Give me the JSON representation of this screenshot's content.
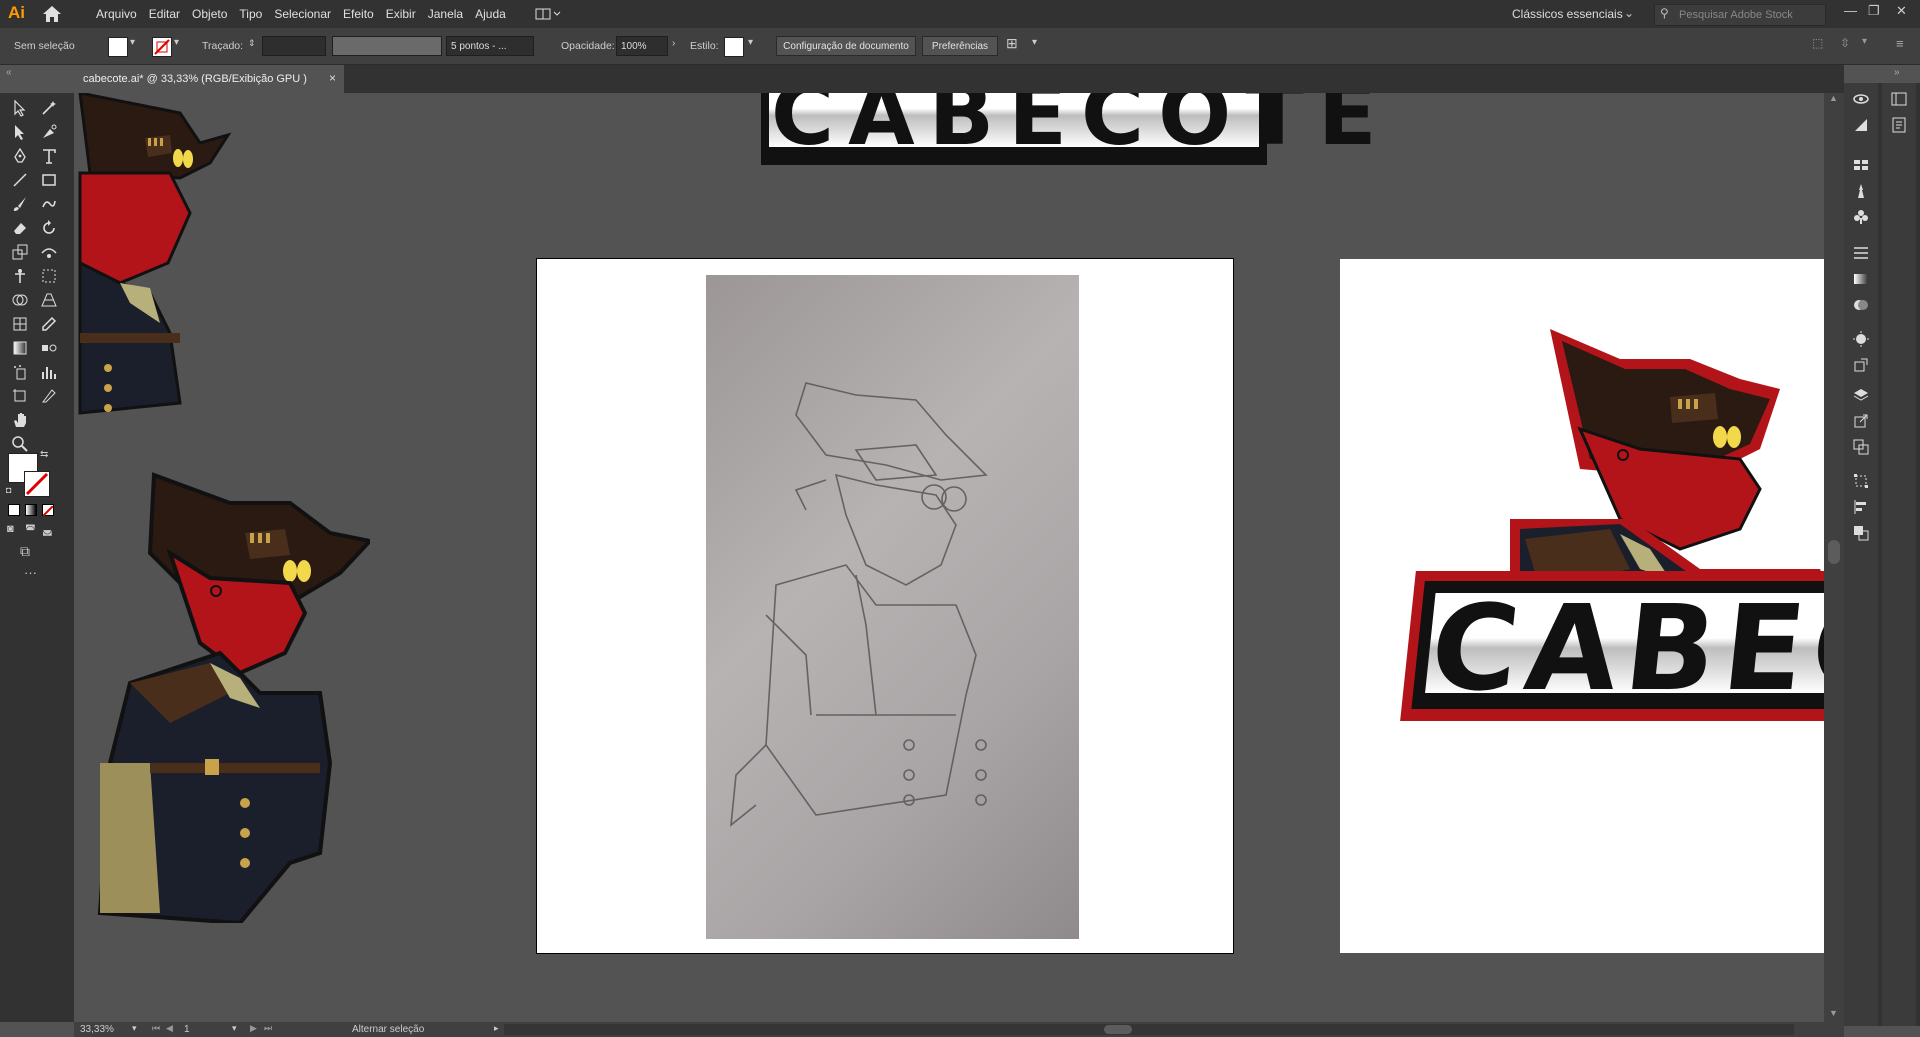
{
  "app": {
    "logo": "Ai"
  },
  "menu": [
    "Arquivo",
    "Editar",
    "Objeto",
    "Tipo",
    "Selecionar",
    "Efeito",
    "Exibir",
    "Janela",
    "Ajuda"
  ],
  "workspace": {
    "label": "Clássicos essenciais"
  },
  "search": {
    "placeholder": "Pesquisar Adobe Stock"
  },
  "control": {
    "selection": "Sem seleção",
    "stroke_label": "Traçado:",
    "brush": "5 pontos - ...",
    "opacity_label": "Opacidade:",
    "opacity_value": "100%",
    "style_label": "Estilo:",
    "doc_setup": "Configuração de documento",
    "prefs": "Preferências"
  },
  "document": {
    "tab": "cabecote.ai* @ 33,33% (RGB/Exibição GPU )",
    "close": "×"
  },
  "status": {
    "zoom": "33,33%",
    "artboard": "1",
    "mode": "Alternar seleção"
  },
  "colors": {
    "accent": "#ff9a00",
    "mascot_red": "#b3141a",
    "bg": "#535353"
  },
  "canvas": {
    "logo_text_top": "CABECOTE",
    "logo_text_right": "CABECO"
  }
}
